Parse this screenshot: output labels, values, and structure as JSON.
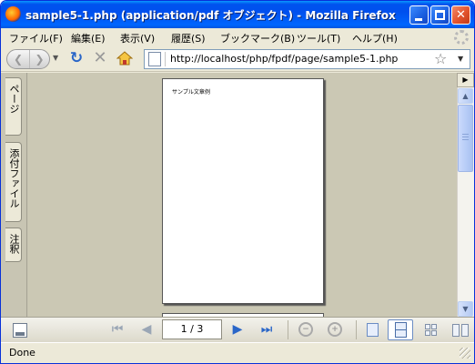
{
  "window": {
    "title": "sample5-1.php (application/pdf オブジェクト) - Mozilla Firefox"
  },
  "menu": {
    "items": [
      "ファイル(F)",
      "編集(E)",
      "表示(V)",
      "履歴(S)",
      "ブックマーク(B)",
      "ツール(T)",
      "ヘルプ(H)"
    ]
  },
  "navbar": {
    "url": "http://localhost/php/fpdf/page/sample5-1.php"
  },
  "sidebar": {
    "tabs": [
      "ページ",
      "添付ファイル",
      "注釈"
    ]
  },
  "pdf": {
    "page_text": "サンプル文章例",
    "page_indicator": "1 / 3"
  },
  "status": {
    "text": "Done"
  },
  "icons": {
    "app": "firefox-icon",
    "back": "back-arrow-icon",
    "forward": "forward-arrow-icon",
    "reload": "reload-icon",
    "stop": "stop-icon",
    "home": "home-icon",
    "bookmark": "star-icon"
  },
  "colors": {
    "titlebar": "#0055ea",
    "viewer_bg": "#cbc8b4",
    "chrome": "#ece9d8",
    "accent_blue": "#2a66c8"
  }
}
